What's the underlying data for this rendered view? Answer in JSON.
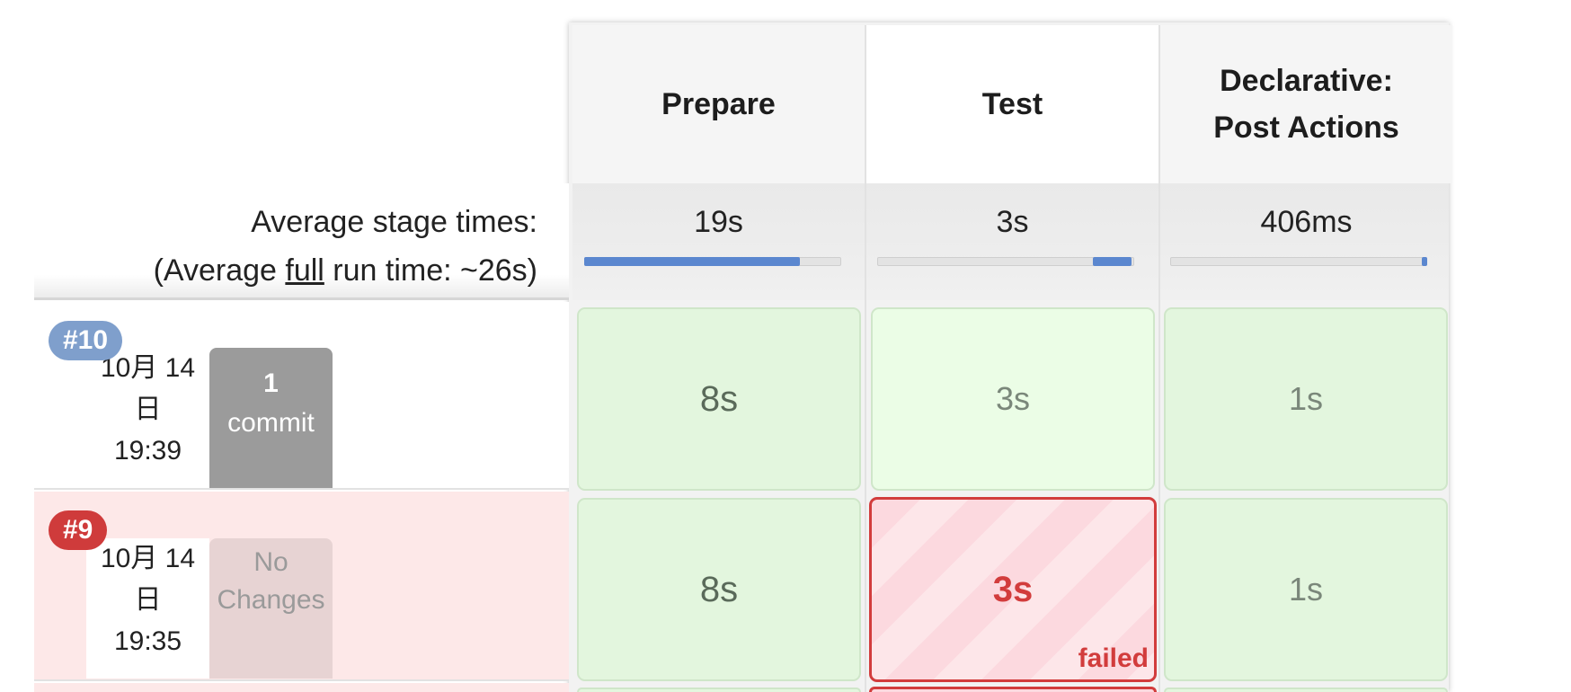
{
  "stages": [
    {
      "name_line1": "Prepare",
      "name_line2": "",
      "avg_time": "19s",
      "bar_fraction": 0.84,
      "bar_start": 0.0
    },
    {
      "name_line1": "Test",
      "name_line2": "",
      "avg_time": "3s",
      "bar_fraction": 0.15,
      "bar_start": 0.84
    },
    {
      "name_line1": "Declarative:",
      "name_line2": "Post Actions",
      "avg_time": "406ms",
      "bar_fraction": 0.02,
      "bar_start": 0.98
    }
  ],
  "averages": {
    "stage_times_label": "Average stage times:",
    "run_prefix": "(Average ",
    "run_link": "full",
    "run_suffix": " run time: ~26s)"
  },
  "builds": [
    {
      "number": "#10",
      "status": "success",
      "date_line1": "10月 14",
      "date_line2": "日",
      "time": "19:39",
      "changes_line1": "1",
      "changes_line2": "commit",
      "durations": [
        "8s",
        "3s",
        "1s"
      ]
    },
    {
      "number": "#9",
      "status": "failed",
      "date_line1": "10月 14",
      "date_line2": "日",
      "time": "19:35",
      "changes_line1": "No",
      "changes_line2": "Changes",
      "durations": [
        "8s",
        "3s",
        "1s"
      ],
      "failed_label": "failed"
    }
  ],
  "colors": {
    "progress_fill": "#5b87cf",
    "success_cell": "#e3f6de",
    "failed_accent": "#d23c3c",
    "failed_row_bg": "#fde8e8",
    "build_badge_success": "#7f9fcc",
    "build_badge_failed": "#cf3b3b"
  }
}
